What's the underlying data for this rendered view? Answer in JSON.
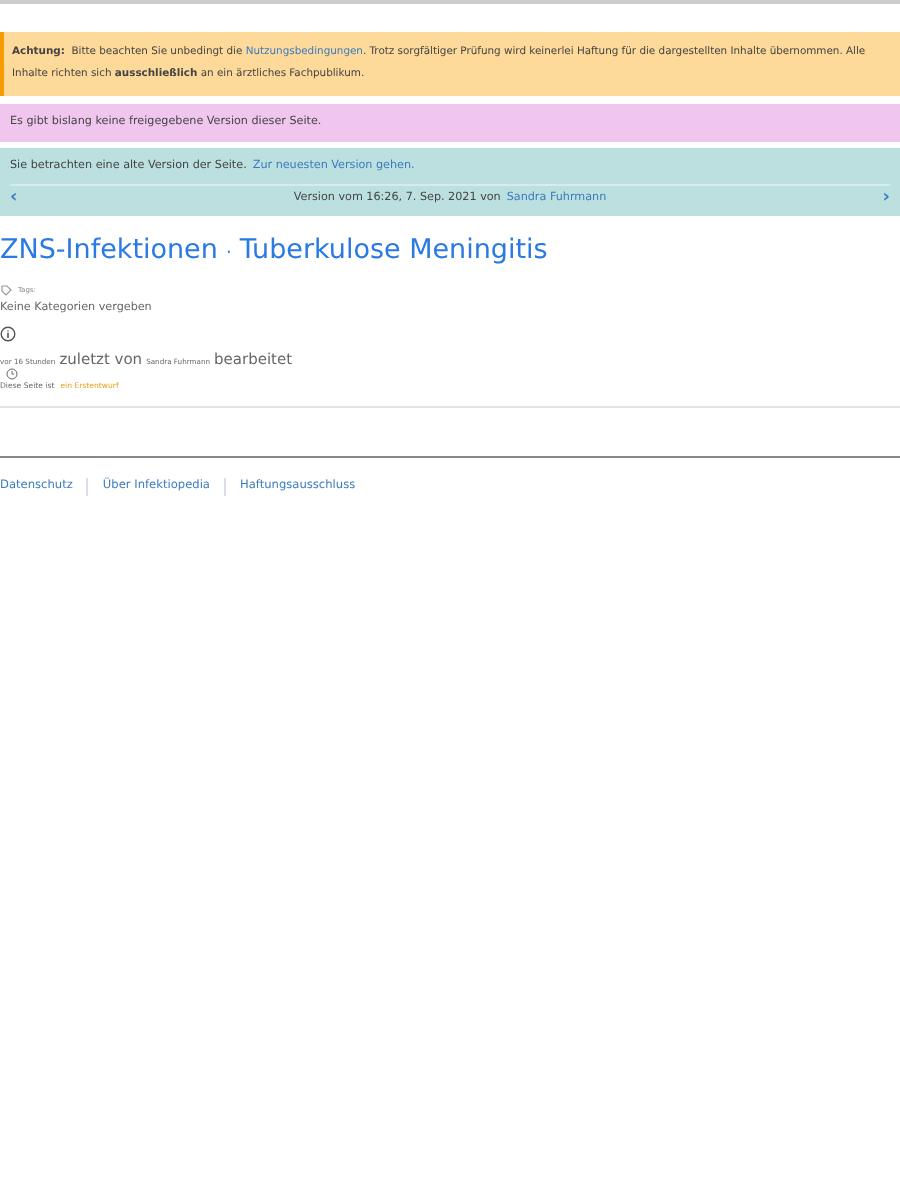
{
  "warning": {
    "label": "Achtung:",
    "text_before": "Bitte beachten Sie unbedingt die",
    "link": "Nutzungsbedingungen",
    "text_after": ". Trotz sorgfältiger Prüfung wird keinerlei Haftung für die dargestellten Inhalte übernommen. Alle Inhalte richten sich **ausschließlich** an ein ärztliches Fachpublikum."
  },
  "release_notice": "Es gibt bislang keine freigegebene Version dieser Seite.",
  "old_version": {
    "text": "Sie betrachten eine alte Version der Seite.",
    "link": "Zur neuesten Version gehen.",
    "prev": "‹",
    "version_text": "Version vom 16:26, 7. Sep. 2021 von",
    "author": "Sandra Fuhrmann",
    "next": "›"
  },
  "title": {
    "parent": "ZNS-Infektionen",
    "separator": "·",
    "page": "Tuberkulose Meningitis"
  },
  "tags": {
    "label": "Tags:",
    "value": "Keine Kategorien vergeben"
  },
  "edited": {
    "time": "vor 16 Stunden",
    "middle": "zuletzt von",
    "user": "Sandra Fuhrmann",
    "end": "bearbeitet"
  },
  "status": {
    "text": "Diese Seite ist",
    "link": "ein Erstentwurf"
  },
  "footer": [
    "Datenschutz",
    "Über Infektiopedia",
    "Haftungsausschluss"
  ]
}
